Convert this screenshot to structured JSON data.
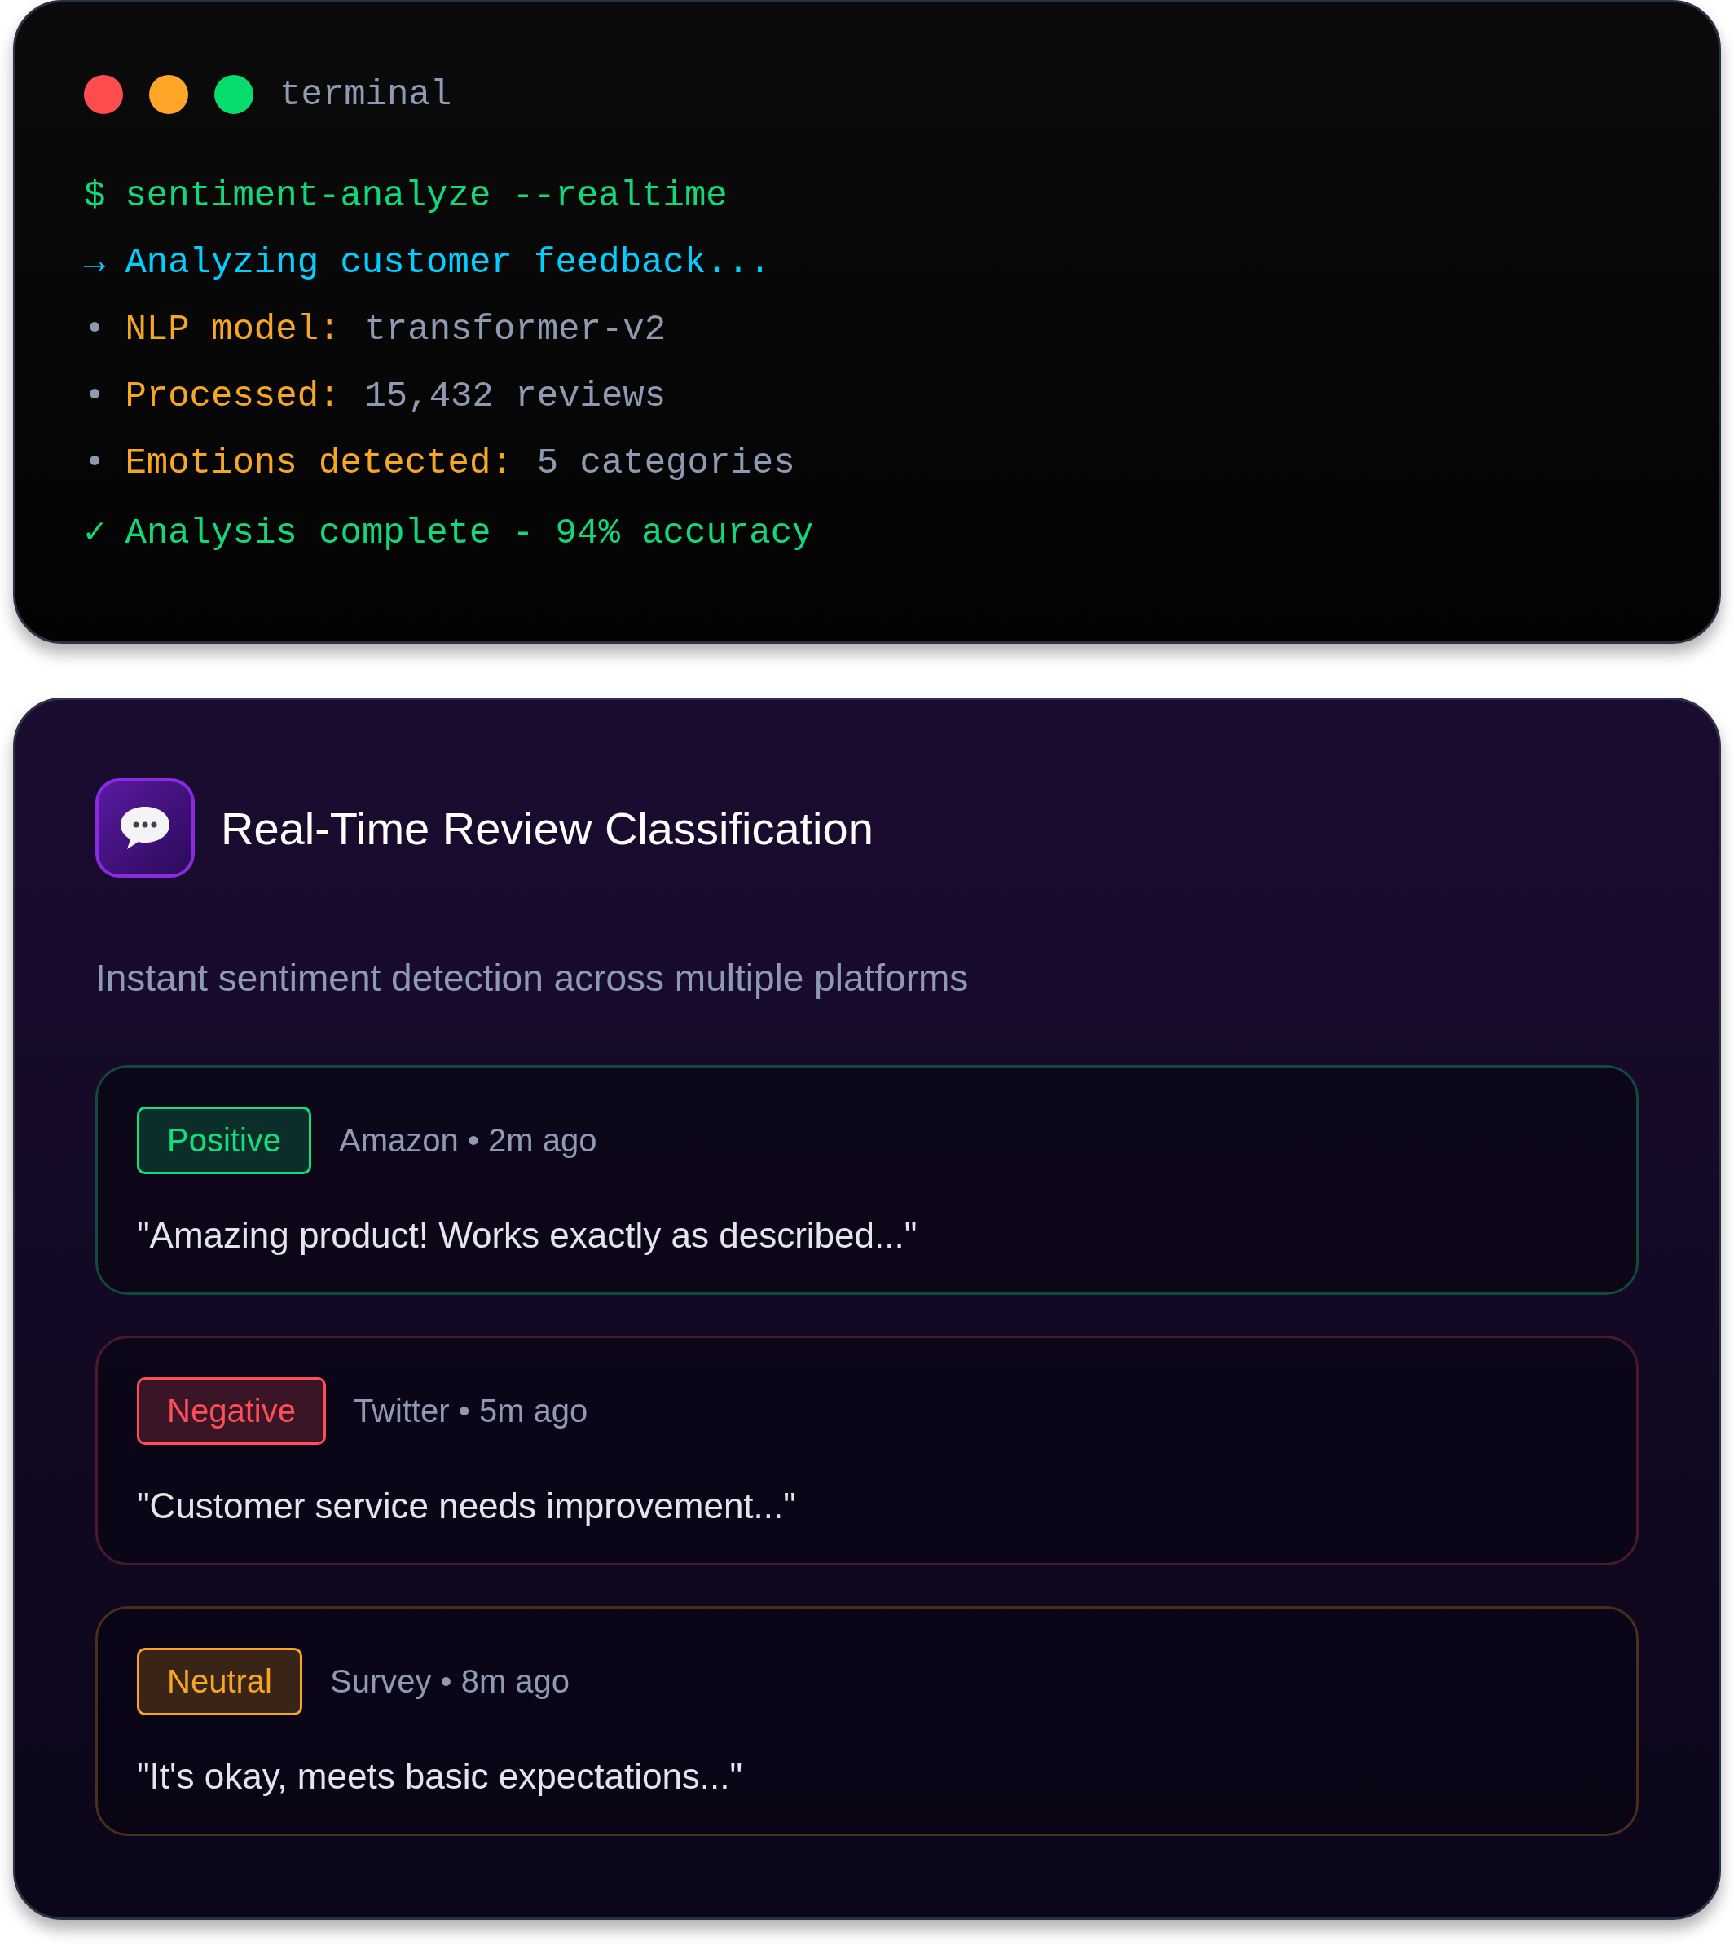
{
  "terminal": {
    "title": "terminal",
    "lines": [
      {
        "kind": "command",
        "prefix": "$",
        "text": "sentiment-analyze --realtime"
      },
      {
        "kind": "info",
        "prefix": "→",
        "text": "Analyzing customer feedback..."
      },
      {
        "kind": "stat",
        "prefix": "•",
        "label": "NLP model:",
        "value": "transformer-v2"
      },
      {
        "kind": "stat",
        "prefix": "•",
        "label": "Processed:",
        "value": "15,432 reviews"
      },
      {
        "kind": "stat",
        "prefix": "•",
        "label": "Emotions detected:",
        "value": "5 categories"
      },
      {
        "kind": "success",
        "prefix": "✓",
        "text": "Analysis complete - 94% accuracy"
      }
    ]
  },
  "panel": {
    "title": "Real-Time Review Classification",
    "subtitle": "Instant sentiment detection across multiple platforms",
    "reviews": [
      {
        "kind": "positive",
        "badge": "Positive",
        "meta": "Amazon • 2m ago",
        "quote": "\"Amazing product! Works exactly as described...\""
      },
      {
        "kind": "negative",
        "badge": "Negative",
        "meta": "Twitter • 5m ago",
        "quote": "\"Customer service needs improvement...\""
      },
      {
        "kind": "neutral",
        "badge": "Neutral",
        "meta": "Survey • 8m ago",
        "quote": "\"It's okay, meets basic expectations...\""
      }
    ]
  }
}
